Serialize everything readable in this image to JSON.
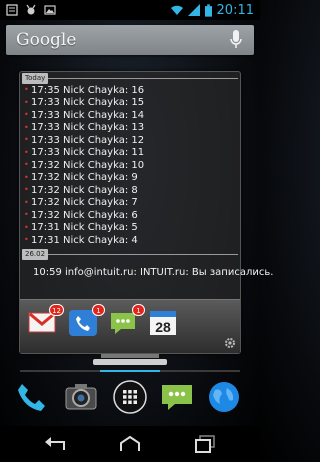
{
  "status_bar": {
    "left_icons": [
      "notes-notification-icon",
      "bug-notification-icon",
      "photo-notification-icon"
    ],
    "right_icons": [
      "wifi-icon",
      "signal-icon",
      "battery-icon"
    ],
    "time": "20:11",
    "accent_color": "#33b5e5"
  },
  "search": {
    "logo": "Google",
    "mic_icon": "microphone-icon"
  },
  "widget": {
    "groups": [
      {
        "date": "Today",
        "entries": [
          "17:35 Nick Chayka: 16",
          "17:33 Nick Chayka: 15",
          "17:33 Nick Chayka: 14",
          "17:33 Nick Chayka: 13",
          "17:33 Nick Chayka: 12",
          "17:33 Nick Chayka: 11",
          "17:32 Nick Chayka: 10",
          "17:32 Nick Chayka: 9",
          "17:32 Nick Chayka: 8",
          "17:32 Nick Chayka: 7",
          "17:32 Nick Chayka: 6",
          "17:31 Nick Chayka: 5",
          "17:31 Nick Chayka: 4"
        ]
      },
      {
        "date": "26.02",
        "entries": [
          "10:59 info@intuit.ru: INTUIT.ru: Вы записались."
        ]
      }
    ],
    "dock_apps": [
      {
        "name": "gmail-icon",
        "badge": "12"
      },
      {
        "name": "phone-icon",
        "badge": "1"
      },
      {
        "name": "messaging-icon",
        "badge": "1"
      },
      {
        "name": "calendar-icon",
        "badge": "",
        "label": "28"
      }
    ],
    "settings_icon": "gear-icon"
  },
  "hotseat": {
    "apps": [
      "phone-app-icon",
      "camera-app-icon",
      "app-drawer-icon",
      "messaging-app-icon",
      "browser-app-icon"
    ]
  },
  "nav_bar": {
    "buttons": [
      "back-icon",
      "home-icon",
      "recents-icon"
    ]
  }
}
